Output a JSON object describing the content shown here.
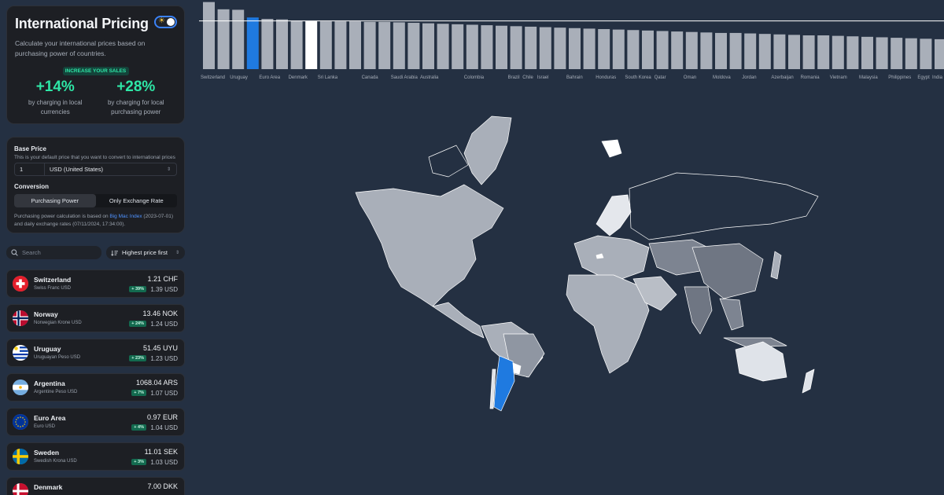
{
  "app": {
    "title": "International Pricing",
    "description": "Calculate your international prices based on purchasing power of countries.",
    "sales_badge": "INCREASE YOUR SALES",
    "stats": [
      {
        "value": "+14%",
        "desc": "by charging in local currencies"
      },
      {
        "value": "+28%",
        "desc": "by charging for local purchasing power"
      }
    ]
  },
  "settings": {
    "base_price_label": "Base Price",
    "base_price_hint": "This is your default price that you want to convert to international prices",
    "amount": "1",
    "currency": "USD (United States)",
    "conversion_label": "Conversion",
    "conversion_options": [
      "Purchasing Power",
      "Only Exchange Rate"
    ],
    "selected_conversion": "Purchasing Power",
    "note_prefix": "Purchasing power calculation is based on ",
    "note_link": "Big Mac Index",
    "note_suffix": " (2023-07-01) and daily exchange rates (07/11/2024, 17:34:00)."
  },
  "search": {
    "placeholder": "Search"
  },
  "sort": {
    "label": "Highest price first"
  },
  "countries": [
    {
      "name": "Switzerland",
      "currency": "Swiss Franc USD",
      "local": "1.21 CHF",
      "pct": "+ 39%",
      "usd": "1.39 USD"
    },
    {
      "name": "Norway",
      "currency": "Norwegian Krone USD",
      "local": "13.46 NOK",
      "pct": "+ 24%",
      "usd": "1.24 USD"
    },
    {
      "name": "Uruguay",
      "currency": "Uruguayan Peso USD",
      "local": "51.45 UYU",
      "pct": "+ 23%",
      "usd": "1.23 USD"
    },
    {
      "name": "Argentina",
      "currency": "Argentine Peso USD",
      "local": "1068.04 ARS",
      "pct": "+ 7%",
      "usd": "1.07 USD"
    },
    {
      "name": "Euro Area",
      "currency": "Euro USD",
      "local": "0.97 EUR",
      "pct": "+ 4%",
      "usd": "1.04 USD"
    },
    {
      "name": "Sweden",
      "currency": "Swedish Krona USD",
      "local": "11.01 SEK",
      "pct": "+ 3%",
      "usd": "1.03 USD"
    },
    {
      "name": "Denmark",
      "currency": "",
      "local": "7.00 DKK",
      "pct": "",
      "usd": ""
    }
  ],
  "chart_data": {
    "type": "bar",
    "title": "",
    "xlabel": "",
    "ylabel": "",
    "reference_line": 1.0,
    "ylim": [
      0,
      1.4
    ],
    "highlight_colors": {
      "blue": "#1f7ae0",
      "white": "#ffffff",
      "default": "#a9afb9"
    },
    "values": [
      1.39,
      1.24,
      1.23,
      1.07,
      1.04,
      1.03,
      1.0,
      1.0,
      0.99,
      0.99,
      0.99,
      0.98,
      0.98,
      0.97,
      0.96,
      0.95,
      0.94,
      0.93,
      0.92,
      0.91,
      0.9,
      0.89,
      0.88,
      0.87,
      0.86,
      0.85,
      0.84,
      0.83,
      0.82,
      0.81,
      0.8,
      0.79,
      0.78,
      0.77,
      0.76,
      0.75,
      0.75,
      0.74,
      0.73,
      0.72,
      0.71,
      0.7,
      0.7,
      0.69,
      0.68,
      0.67,
      0.66,
      0.65,
      0.64,
      0.63,
      0.62,
      0.61,
      0.6
    ],
    "highlights": {
      "blue": [
        3
      ],
      "white": [
        7
      ]
    },
    "tick_labels": [
      {
        "index": 0,
        "label": "Switzerland"
      },
      {
        "index": 2,
        "label": "Uruguay"
      },
      {
        "index": 4,
        "label": "Euro Area"
      },
      {
        "index": 6,
        "label": "Denmark"
      },
      {
        "index": 8,
        "label": "Sri Lanka"
      },
      {
        "index": 11,
        "label": "Canada"
      },
      {
        "index": 13,
        "label": "Saudi Arabia"
      },
      {
        "index": 15,
        "label": "Australia"
      },
      {
        "index": 18,
        "label": "Colombia"
      },
      {
        "index": 21,
        "label": "Brazil"
      },
      {
        "index": 22,
        "label": "Chile"
      },
      {
        "index": 23,
        "label": "Israel"
      },
      {
        "index": 25,
        "label": "Bahrain"
      },
      {
        "index": 27,
        "label": "Honduras"
      },
      {
        "index": 29,
        "label": "South Korea"
      },
      {
        "index": 31,
        "label": "Qatar"
      },
      {
        "index": 33,
        "label": "Oman"
      },
      {
        "index": 35,
        "label": "Moldova"
      },
      {
        "index": 37,
        "label": "Jordan"
      },
      {
        "index": 39,
        "label": "Azerbaijan"
      },
      {
        "index": 41,
        "label": "Romania"
      },
      {
        "index": 43,
        "label": "Vietnam"
      },
      {
        "index": 45,
        "label": "Malaysia"
      },
      {
        "index": 47,
        "label": "Philippines"
      },
      {
        "index": 49,
        "label": "Egypt"
      },
      {
        "index": 50,
        "label": "India"
      }
    ]
  }
}
